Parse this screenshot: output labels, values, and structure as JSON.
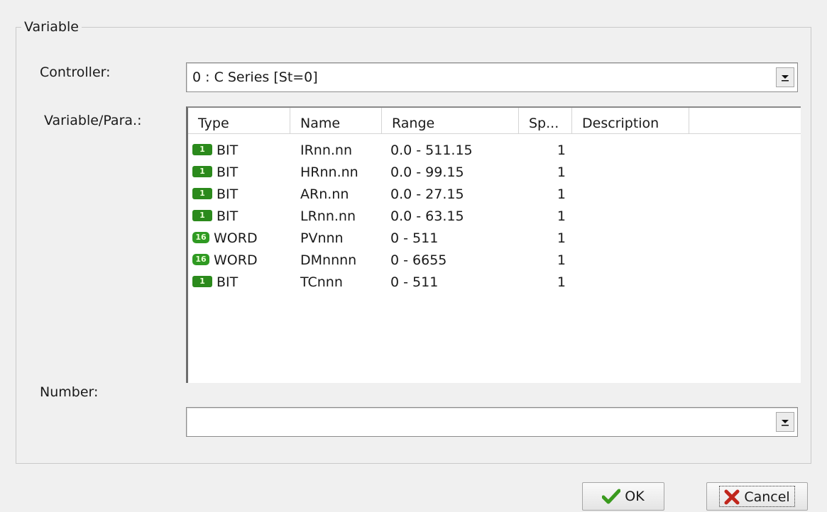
{
  "group": {
    "title": "Variable"
  },
  "controller": {
    "label": "Controller:",
    "value": "0 : C Series [St=0]"
  },
  "variable": {
    "label": "Variable/Para.:",
    "columns": [
      "Type",
      "Name",
      "Range",
      "Sp...",
      "Description"
    ],
    "rows": [
      {
        "icon": "1",
        "type": "BIT",
        "name": "IRnn.nn",
        "range": "0.0 - 511.15",
        "sp": "1"
      },
      {
        "icon": "1",
        "type": "BIT",
        "name": "HRnn.nn",
        "range": "0.0 - 99.15",
        "sp": "1"
      },
      {
        "icon": "1",
        "type": "BIT",
        "name": "ARn.nn",
        "range": "0.0 - 27.15",
        "sp": "1"
      },
      {
        "icon": "1",
        "type": "BIT",
        "name": "LRnn.nn",
        "range": "0.0 - 63.15",
        "sp": "1"
      },
      {
        "icon": "16",
        "type": "WORD",
        "name": "PVnnn",
        "range": "0 - 511",
        "sp": "1"
      },
      {
        "icon": "16",
        "type": "WORD",
        "name": "DMnnnn",
        "range": "0 - 6655",
        "sp": "1"
      },
      {
        "icon": "1",
        "type": "BIT",
        "name": "TCnnn",
        "range": "0 - 511",
        "sp": "1"
      }
    ]
  },
  "number": {
    "label": "Number:",
    "value": ""
  },
  "buttons": {
    "ok": "OK",
    "cancel": "Cancel"
  },
  "icons": {
    "ok": "checkmark-icon",
    "cancel": "x-icon",
    "dropdown": "chevron-down-icon",
    "bit": "bit-type-icon",
    "word": "word-type-icon"
  },
  "colors": {
    "type_icon": "#2b8a1c",
    "ok_check": "#3a9a1e",
    "cancel_x": "#c0261c"
  }
}
